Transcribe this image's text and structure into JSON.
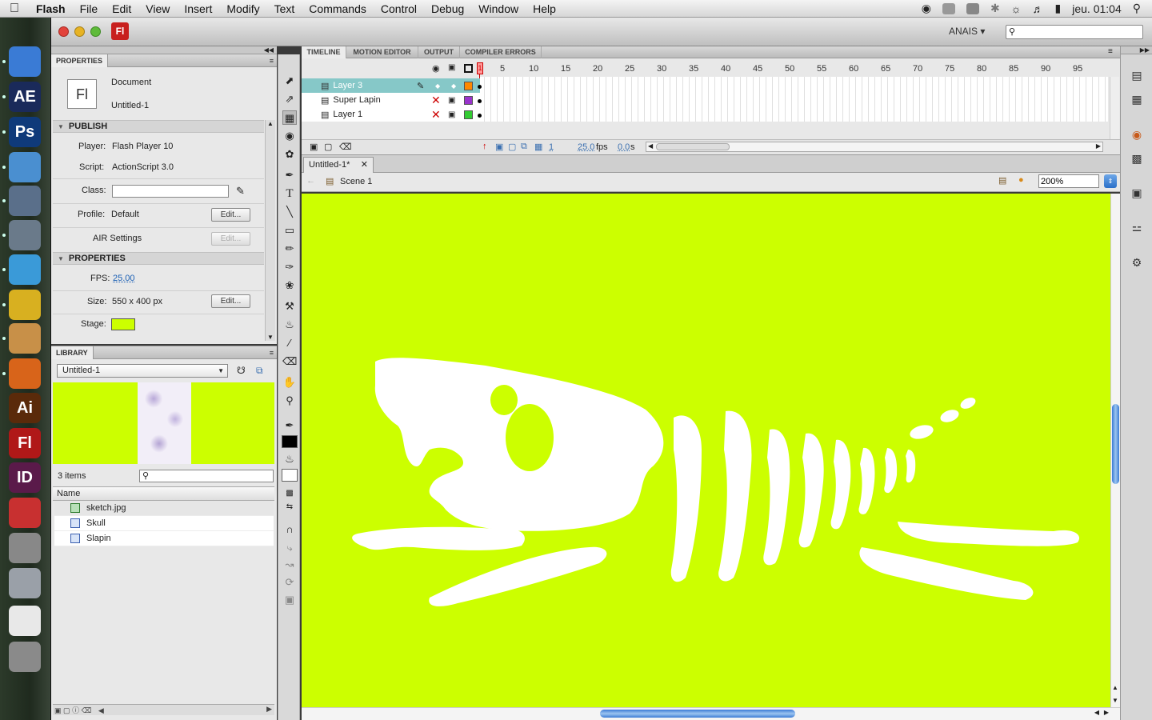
{
  "menubar": {
    "app": "Flash",
    "items": [
      "File",
      "Edit",
      "View",
      "Insert",
      "Modify",
      "Text",
      "Commands",
      "Control",
      "Debug",
      "Window",
      "Help"
    ],
    "clock": "jeu. 01:04"
  },
  "window": {
    "workspace": "ANAIS ▾",
    "fl_icon": "Fl"
  },
  "dock": {
    "apps": [
      {
        "label": "",
        "color": "#3a7bd5",
        "icon": "finder-icon"
      },
      {
        "label": "AE",
        "color": "#1a2a5a",
        "icon": "after-effects-icon"
      },
      {
        "label": "Ps",
        "color": "#0f3a7a",
        "icon": "photoshop-icon"
      },
      {
        "label": "",
        "color": "#4a8fd0",
        "icon": "virtualbox-icon"
      },
      {
        "label": "",
        "color": "#5a6f8a",
        "icon": "preview-icon"
      },
      {
        "label": "",
        "color": "#6a7a8a",
        "icon": "iphoto-icon"
      },
      {
        "label": "",
        "color": "#3a9ad8",
        "icon": "itunes-icon"
      },
      {
        "label": "",
        "color": "#d8b020",
        "icon": "adium-icon"
      },
      {
        "label": "",
        "color": "#c89048",
        "icon": "mail-icon"
      },
      {
        "label": "",
        "color": "#d8641a",
        "icon": "firefox-icon"
      },
      {
        "label": "Ai",
        "color": "#5a2a0a",
        "icon": "illustrator-icon"
      },
      {
        "label": "Fl",
        "color": "#b01818",
        "icon": "flash-icon"
      },
      {
        "label": "ID",
        "color": "#5a1a4a",
        "icon": "indesign-icon"
      },
      {
        "label": "",
        "color": "#c83030",
        "icon": "acrobat-icon"
      },
      {
        "label": "",
        "color": "#888888",
        "icon": "script-icon"
      },
      {
        "label": "",
        "color": "#9aa0a8",
        "icon": "bin-icon"
      },
      {
        "label": "",
        "color": "#e8e8e8",
        "icon": "document-icon"
      },
      {
        "label": "",
        "color": "#8a8a8a",
        "icon": "trash-icon"
      }
    ]
  },
  "properties": {
    "tab": "PROPERTIES",
    "doc_type": "Document",
    "doc_name": "Untitled-1",
    "doc_icon": "Fl",
    "publish_header": "PUBLISH",
    "player_label": "Player:",
    "player_value": "Flash Player 10",
    "script_label": "Script:",
    "script_value": "ActionScript 3.0",
    "class_label": "Class:",
    "class_value": "",
    "profile_label": "Profile:",
    "profile_value": "Default",
    "edit_label": "Edit...",
    "air_label": "AIR Settings",
    "props_header": "PROPERTIES",
    "fps_label": "FPS:",
    "fps_value": "25.00",
    "size_label": "Size:",
    "size_value": "550 x 400 px",
    "stage_label": "Stage:",
    "stage_color": "#ccff00"
  },
  "library": {
    "tab": "LIBRARY",
    "doc": "Untitled-1",
    "count": "3 items",
    "name_header": "Name",
    "items": [
      {
        "name": "sketch.jpg",
        "icon": "bitmap-icon"
      },
      {
        "name": "Skull",
        "icon": "movieclip-icon"
      },
      {
        "name": "Slapin",
        "icon": "movieclip-icon"
      }
    ]
  },
  "timeline": {
    "tabs": [
      "TIMELINE",
      "MOTION EDITOR",
      "OUTPUT",
      "COMPILER ERRORS"
    ],
    "frame_numbers": [
      "1",
      "5",
      "10",
      "15",
      "20",
      "25",
      "30",
      "35",
      "40",
      "45",
      "50",
      "55",
      "60",
      "65",
      "70",
      "75",
      "80",
      "85",
      "90",
      "95"
    ],
    "layers": [
      {
        "name": "Layer 3",
        "selected": true,
        "hidden": false,
        "color": "#ff8800"
      },
      {
        "name": "Super Lapin",
        "selected": false,
        "hidden": true,
        "color": "#9933cc"
      },
      {
        "name": "Layer 1",
        "selected": false,
        "hidden": true,
        "color": "#33cc33"
      }
    ],
    "current_frame": "1",
    "fps": "25.0",
    "fps_unit": "fps",
    "time": "0.0",
    "time_unit": "s"
  },
  "document": {
    "tab": "Untitled-1*",
    "scene": "Scene 1",
    "zoom": "200%"
  },
  "colors": {
    "stage": "#ccff00",
    "selected_layer": "#86c8c8",
    "playhead": "#cc0000"
  }
}
